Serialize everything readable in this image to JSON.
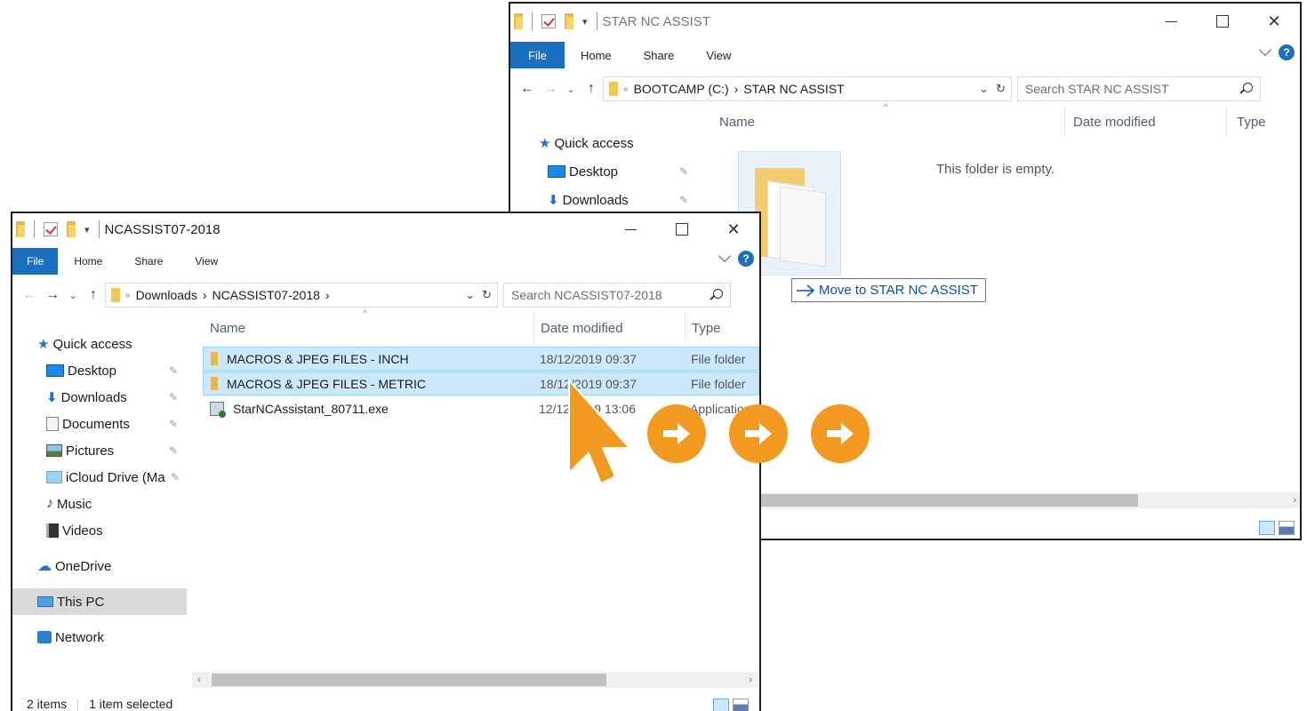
{
  "back_window": {
    "title": "STAR NC ASSIST",
    "ribbon_tabs": [
      "File",
      "Home",
      "Share",
      "View"
    ],
    "address": {
      "prefix": "«",
      "path": [
        "BOOTCAMP (C:)",
        "STAR NC ASSIST"
      ]
    },
    "search_placeholder": "Search STAR NC ASSIST",
    "columns": [
      "Name",
      "Date modified",
      "Type"
    ],
    "nav_items": [
      {
        "label": "Quick access",
        "icon": "star-icon"
      },
      {
        "label": "Desktop",
        "icon": "desktop-icon",
        "pinned": true
      },
      {
        "label": "Downloads",
        "icon": "download-icon",
        "pinned": true
      }
    ],
    "empty_message": "This folder is empty."
  },
  "drag_tooltip": {
    "text": "Move to STAR NC ASSIST"
  },
  "front_window": {
    "title": "NCASSIST07-2018",
    "ribbon_tabs": [
      "File",
      "Home",
      "Share",
      "View"
    ],
    "address": {
      "prefix": "«",
      "path": [
        "Downloads",
        "NCASSIST07-2018"
      ]
    },
    "search_placeholder": "Search NCASSIST07-2018",
    "columns": [
      "Name",
      "Date modified",
      "Type"
    ],
    "nav_items": [
      {
        "label": "Quick access",
        "icon": "star-icon"
      },
      {
        "label": "Desktop",
        "icon": "desktop-icon",
        "pinned": true
      },
      {
        "label": "Downloads",
        "icon": "download-icon",
        "pinned": true
      },
      {
        "label": "Documents",
        "icon": "document-icon",
        "pinned": true
      },
      {
        "label": "Pictures",
        "icon": "pictures-icon",
        "pinned": true
      },
      {
        "label": "iCloud Drive (Ma",
        "icon": "icloud-icon",
        "pinned": true
      },
      {
        "label": "Music",
        "icon": "music-icon"
      },
      {
        "label": "Videos",
        "icon": "video-icon"
      },
      {
        "label": "OneDrive",
        "icon": "onedrive-icon"
      },
      {
        "label": "This PC",
        "icon": "pc-icon",
        "selected": true
      },
      {
        "label": "Network",
        "icon": "network-icon"
      }
    ],
    "files": [
      {
        "name": "MACROS & JPEG FILES - INCH",
        "date": "18/12/2019 09:37",
        "type": "File folder",
        "kind": "folder",
        "selected": true
      },
      {
        "name": "MACROS & JPEG FILES - METRIC",
        "date": "18/12/2019 09:37",
        "type": "File folder",
        "kind": "folder",
        "selected": true
      },
      {
        "name": "StarNCAssistant_80711.exe",
        "date": "12/12/2019 13:06",
        "type": "Application",
        "kind": "exe",
        "selected": false
      }
    ],
    "status": {
      "items": "2 items",
      "selection": "1 item selected"
    }
  },
  "colors": {
    "accent": "#1a6fc0",
    "selection": "#cce8ff",
    "arrow_orange": "#f29a1f"
  }
}
